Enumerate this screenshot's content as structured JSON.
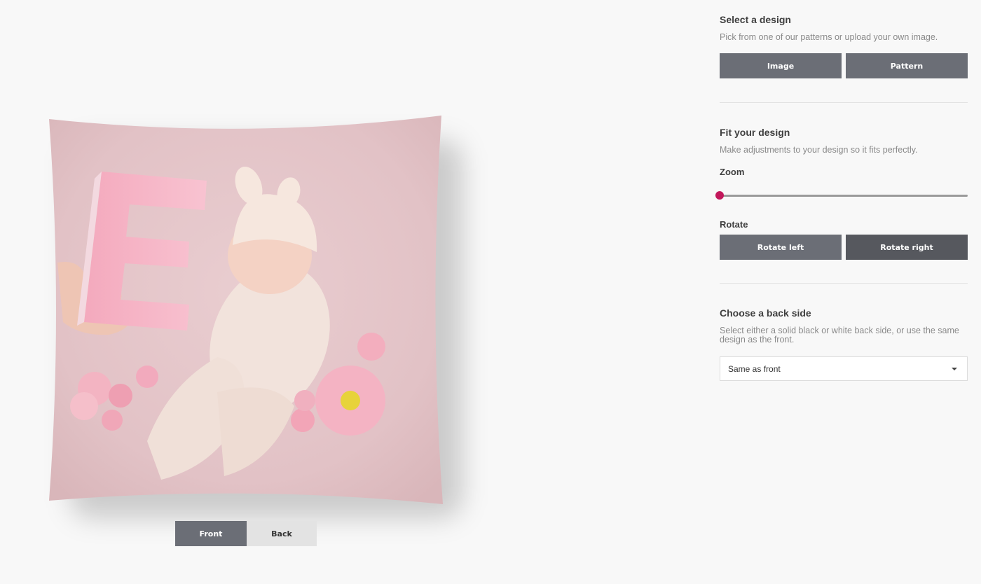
{
  "preview": {
    "side_tabs": [
      {
        "label": "Front",
        "active": true
      },
      {
        "label": "Back",
        "active": false
      }
    ]
  },
  "design": {
    "title": "Select a design",
    "description": "Pick from one of our patterns or upload your own image.",
    "buttons": [
      "Image",
      "Pattern"
    ]
  },
  "fit": {
    "title": "Fit your design",
    "description": "Make adjustments to your design so it fits perfectly.",
    "zoom_label": "Zoom",
    "zoom_value": 0,
    "rotate_label": "Rotate",
    "rotate_buttons": [
      "Rotate left",
      "Rotate right"
    ]
  },
  "back_side": {
    "title": "Choose a back side",
    "description": "Select either a solid black or white back side, or use the same design as the front.",
    "selected": "Same as front"
  },
  "colors": {
    "accent": "#c2185b",
    "button": "#6b6e76",
    "button_dark": "#56585e"
  }
}
